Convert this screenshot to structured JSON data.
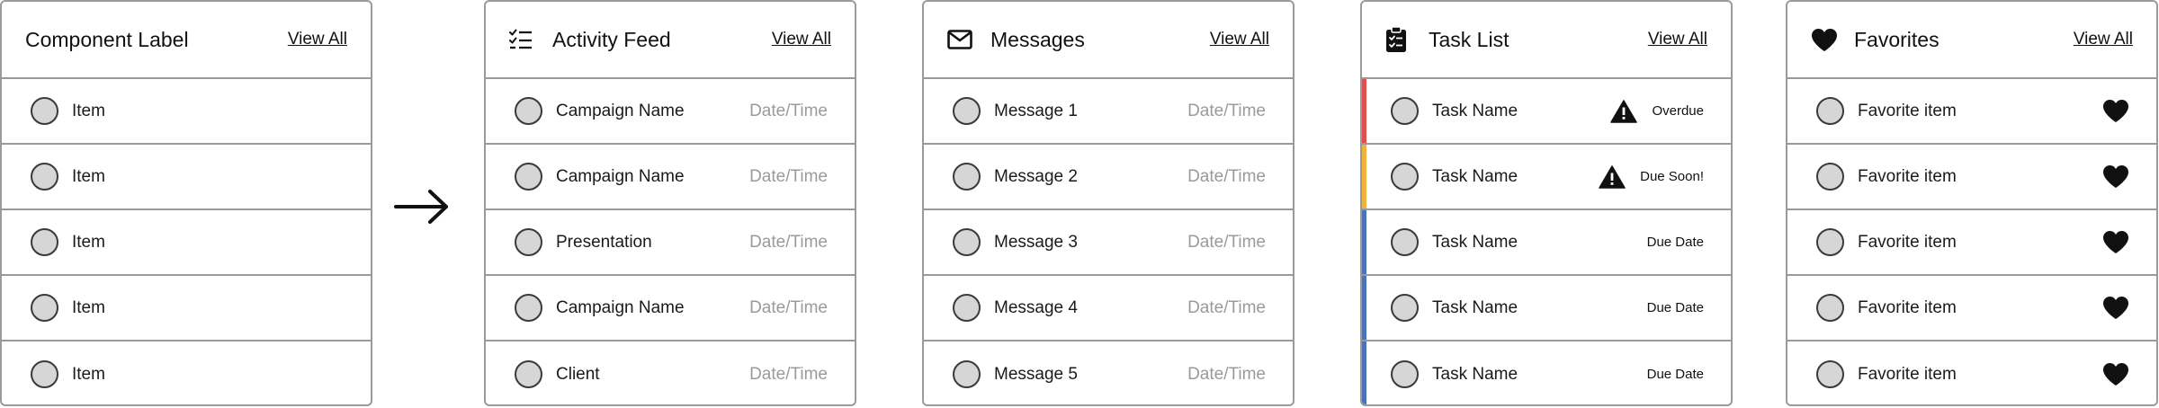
{
  "colors": {
    "border": "#9a9a9a",
    "avatar_fill": "#d6d6d6",
    "muted_text": "#9a9a9a",
    "overdue_accent": "#e0504f",
    "due_soon_accent": "#f0b23d",
    "due_date_accent": "#4a74b8"
  },
  "cards": [
    {
      "title": "Component Label",
      "icon": "none",
      "view_all": "View All",
      "rows": [
        {
          "label": "Item"
        },
        {
          "label": "Item"
        },
        {
          "label": "Item"
        },
        {
          "label": "Item"
        },
        {
          "label": "Item"
        }
      ]
    },
    {
      "title": "Activity Feed",
      "icon": "checklist-icon",
      "view_all": "View All",
      "rows": [
        {
          "label": "Campaign Name",
          "meta": "Date/Time"
        },
        {
          "label": "Campaign Name",
          "meta": "Date/Time"
        },
        {
          "label": "Presentation",
          "meta": "Date/Time"
        },
        {
          "label": "Campaign Name",
          "meta": "Date/Time"
        },
        {
          "label": "Client",
          "meta": "Date/Time"
        }
      ]
    },
    {
      "title": "Messages",
      "icon": "envelope-icon",
      "view_all": "View All",
      "rows": [
        {
          "label": "Message 1",
          "meta": "Date/Time"
        },
        {
          "label": "Message 2",
          "meta": "Date/Time"
        },
        {
          "label": "Message 3",
          "meta": "Date/Time"
        },
        {
          "label": "Message 4",
          "meta": "Date/Time"
        },
        {
          "label": "Message 5",
          "meta": "Date/Time"
        }
      ]
    },
    {
      "title": "Task List",
      "icon": "clipboard-check-icon",
      "view_all": "View All",
      "rows": [
        {
          "label": "Task Name",
          "status": "Overdue",
          "icon": "warning-icon"
        },
        {
          "label": "Task Name",
          "status": "Due Soon!",
          "icon": "warning-icon"
        },
        {
          "label": "Task Name",
          "status": "Due Date"
        },
        {
          "label": "Task Name",
          "status": "Due Date"
        },
        {
          "label": "Task Name",
          "status": "Due Date"
        }
      ]
    },
    {
      "title": "Favorites",
      "icon": "heart-icon",
      "view_all": "View All",
      "rows": [
        {
          "label": "Favorite item",
          "icon": "heart-icon"
        },
        {
          "label": "Favorite item",
          "icon": "heart-icon"
        },
        {
          "label": "Favorite item",
          "icon": "heart-icon"
        },
        {
          "label": "Favorite item",
          "icon": "heart-icon"
        },
        {
          "label": "Favorite item",
          "icon": "heart-icon"
        }
      ]
    }
  ],
  "transition_icon": "arrow-right-icon"
}
